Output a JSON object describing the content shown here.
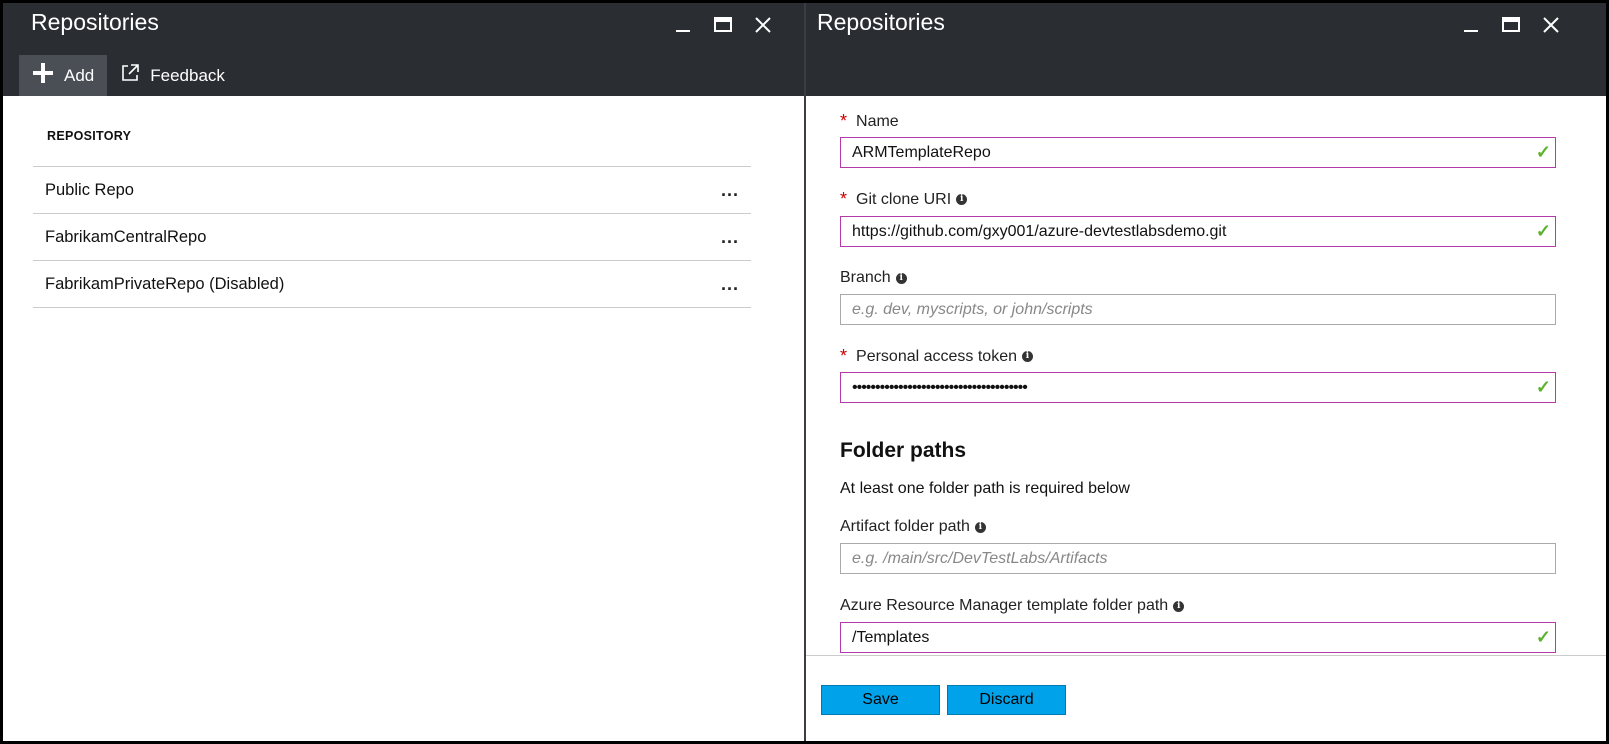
{
  "left": {
    "title": "Repositories",
    "toolbar": {
      "add_label": "Add",
      "feedback_label": "Feedback"
    },
    "section_header": "REPOSITORY",
    "repos": [
      {
        "name": "Public Repo",
        "more": "..."
      },
      {
        "name": "FabrikamCentralRepo",
        "more": "..."
      },
      {
        "name": "FabrikamPrivateRepo (Disabled)",
        "more": "..."
      }
    ]
  },
  "right": {
    "title": "Repositories",
    "fields": {
      "name": {
        "label": "Name",
        "value": "ARMTemplateRepo"
      },
      "git_uri": {
        "label": "Git clone URI",
        "value": "https://github.com/gxy001/azure-devtestlabsdemo.git"
      },
      "branch": {
        "label": "Branch",
        "placeholder": "e.g. dev, myscripts, or john/scripts"
      },
      "token": {
        "label": "Personal access token",
        "value": "••••••••••••••••••••••••••••••••••••••"
      }
    },
    "folder_paths": {
      "heading": "Folder paths",
      "note": "At least one folder path is required below",
      "artifact": {
        "label": "Artifact folder path",
        "placeholder": "e.g. /main/src/DevTestLabs/Artifacts"
      },
      "arm": {
        "label": "Azure Resource Manager template folder path",
        "value": "/Templates"
      }
    },
    "buttons": {
      "save": "Save",
      "discard": "Discard"
    }
  },
  "window_controls": {
    "minimize": "minimize",
    "maximize": "maximize",
    "close": "close"
  },
  "colors": {
    "header_bg": "#2a2e33",
    "button_bg": "#00a2ea",
    "valid_border": "#b23aab",
    "check": "#5bb32b",
    "required": "#cc0000"
  }
}
